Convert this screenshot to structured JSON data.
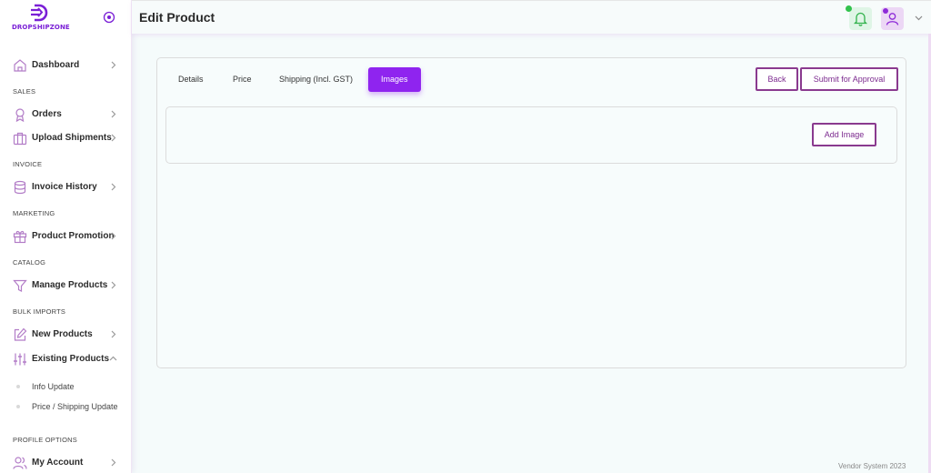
{
  "brand": {
    "name": "DROPSHIPZONE",
    "accent": "#7a1fd6"
  },
  "header": {
    "title": "Edit Product"
  },
  "sidebar": {
    "sections": {
      "sales": "SALES",
      "invoice": "INVOICE",
      "marketing": "MARKETING",
      "catalog": "CATALOG",
      "bulk_imports": "BULK IMPORTS",
      "profile_options": "PROFILE OPTIONS"
    },
    "items": {
      "dashboard": "Dashboard",
      "orders": "Orders",
      "upload_shipments": "Upload Shipments",
      "invoice_history": "Invoice History",
      "product_promotion": "Product Promotion",
      "manage_products": "Manage Products",
      "new_products": "New Products",
      "existing_products": "Existing Products",
      "my_account": "My Account"
    },
    "sub_items": {
      "info_update": "Info Update",
      "price_shipping_update": "Price / Shipping Update"
    }
  },
  "tabs": {
    "details": "Details",
    "price": "Price",
    "shipping": "Shipping (Incl. GST)",
    "images": "Images"
  },
  "actions": {
    "back": "Back",
    "submit": "Submit for Approval",
    "add_image": "Add Image"
  },
  "footer": {
    "text": "Vendor System 2023"
  },
  "colors": {
    "active_tab": "#8f24ef",
    "button_border": "#8a3a8f",
    "notification_dot": "#32c24d"
  }
}
